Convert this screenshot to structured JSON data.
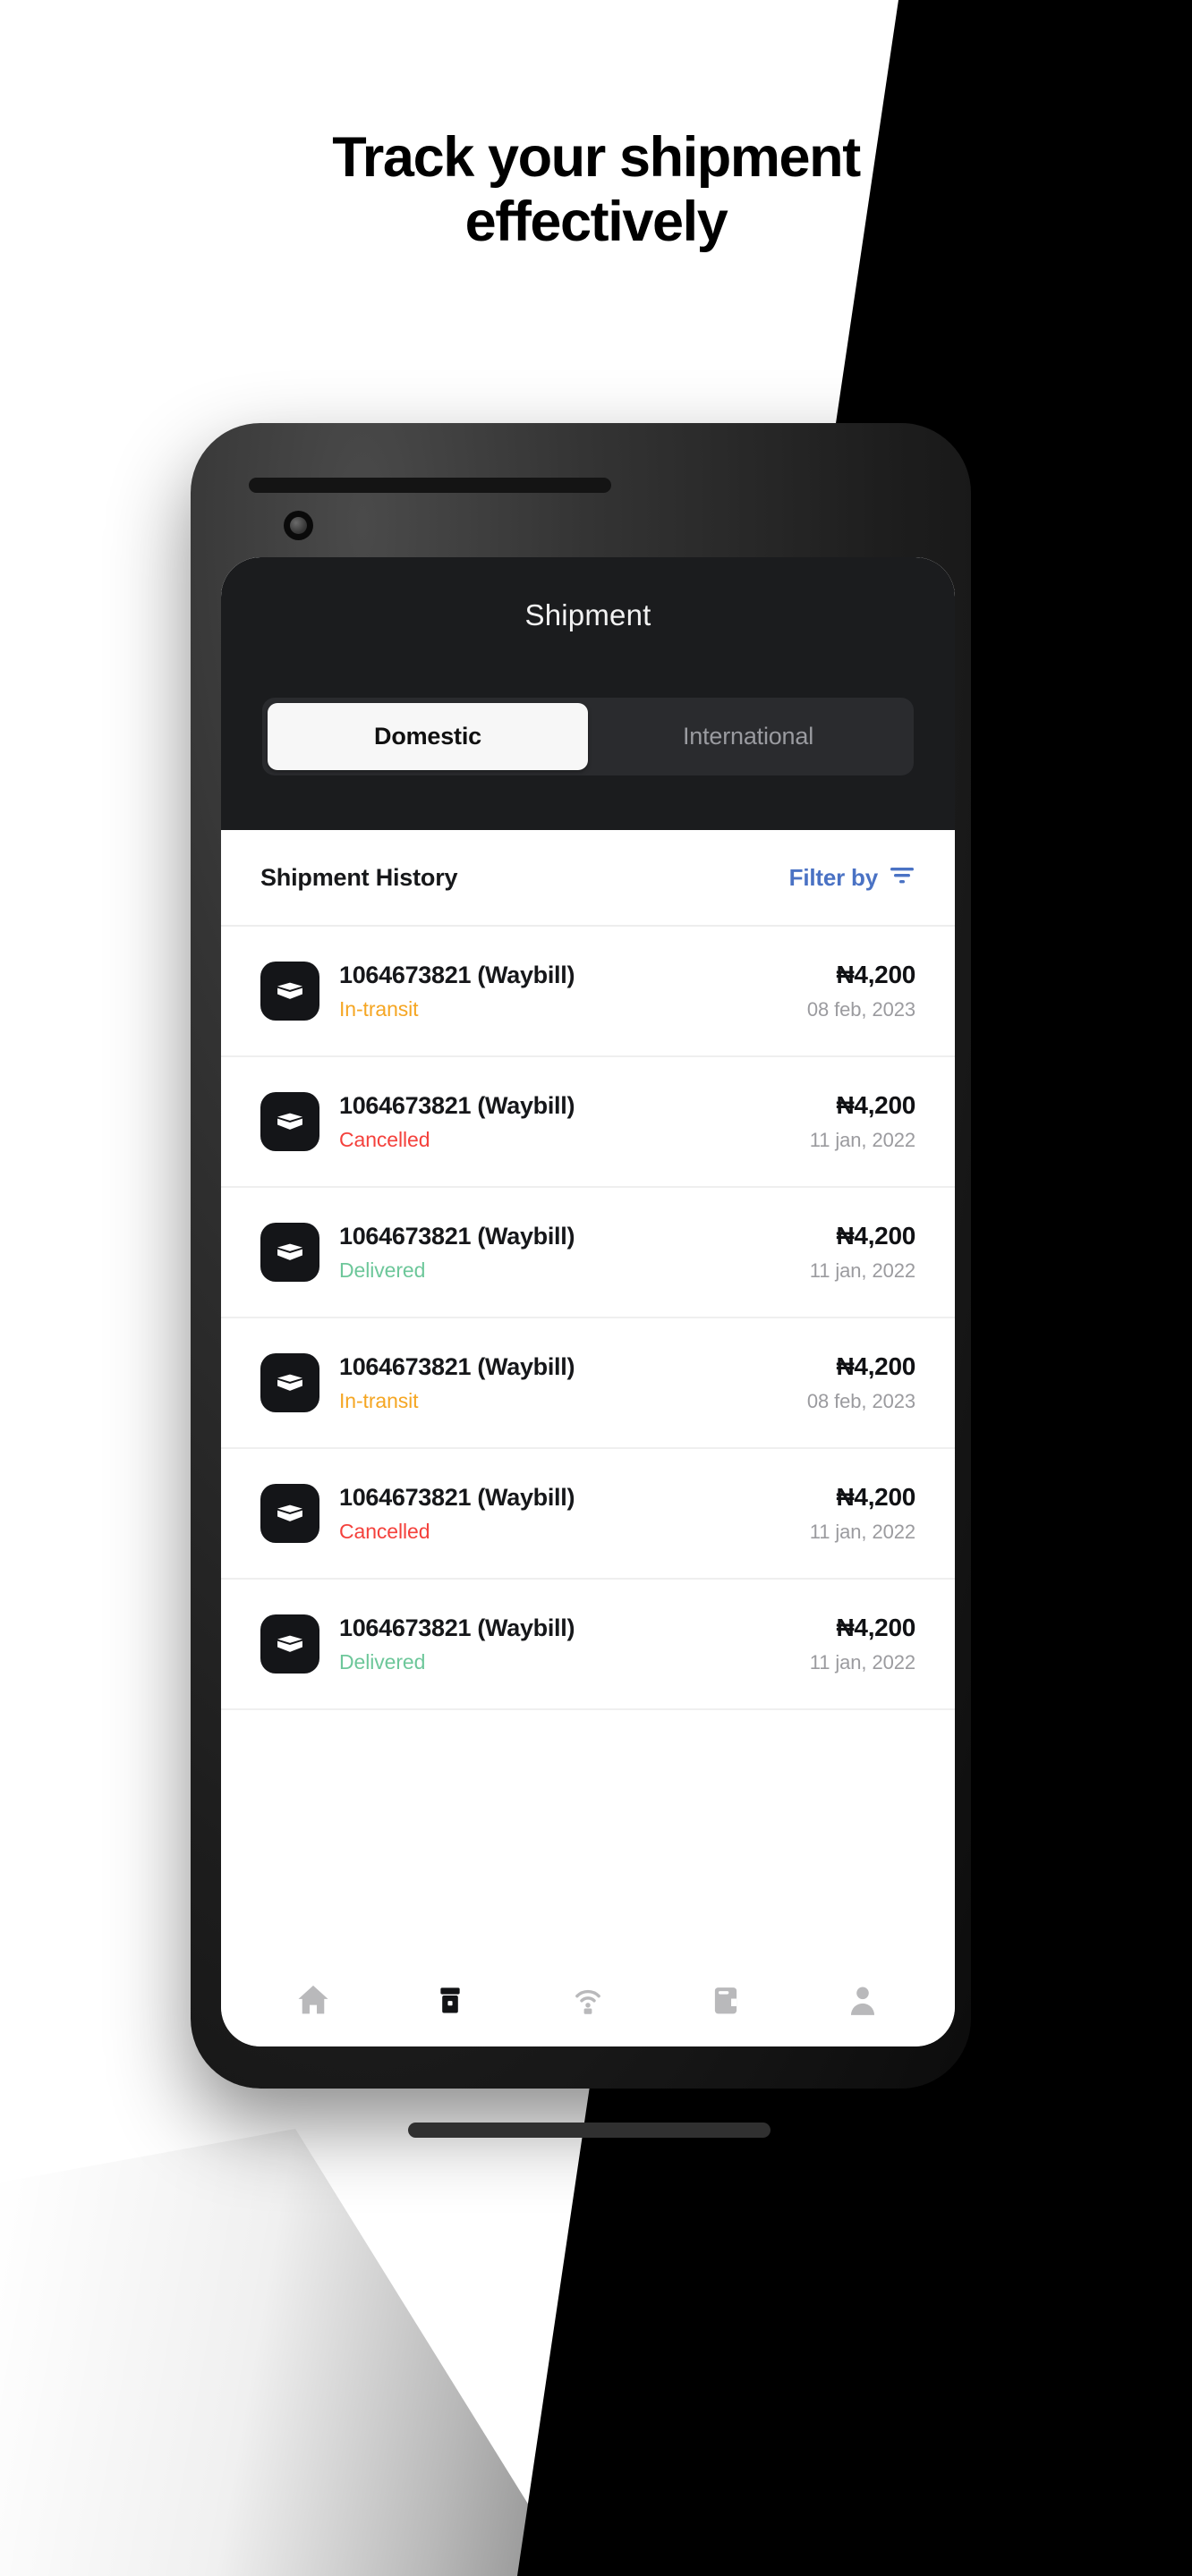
{
  "headline": {
    "line1": "Track your shipment",
    "line2": "effectively"
  },
  "colors": {
    "background": "#ffffff",
    "wedge": "#000000",
    "app_header_bg": "#1b1c1e",
    "accent_blue": "#4a72c4",
    "status_in_transit": "#f5a623",
    "status_cancelled": "#f4413c",
    "status_delivered": "#6dc79a",
    "active_tab_bg": "#f7f7f7",
    "icon_tile_bg": "#141518"
  },
  "app": {
    "title": "Shipment",
    "tabs": [
      {
        "label": "Domestic",
        "active": true
      },
      {
        "label": "International",
        "active": false
      }
    ],
    "list": {
      "title": "Shipment History",
      "filter_label": "Filter by",
      "filter_icon": "filter-icon",
      "rows": [
        {
          "icon": "package-box-icon",
          "id": "1064673821 (Waybill)",
          "status": "In-transit",
          "status_color": "#f5a623",
          "amount": "₦4,200",
          "date": "08 feb, 2023"
        },
        {
          "icon": "package-box-icon",
          "id": "1064673821 (Waybill)",
          "status": "Cancelled",
          "status_color": "#f4413c",
          "amount": "₦4,200",
          "date": "11 jan, 2022"
        },
        {
          "icon": "package-box-icon",
          "id": "1064673821 (Waybill)",
          "status": "Delivered",
          "status_color": "#6dc79a",
          "amount": "₦4,200",
          "date": "11 jan, 2022"
        },
        {
          "icon": "package-box-icon",
          "id": "1064673821 (Waybill)",
          "status": "In-transit",
          "status_color": "#f5a623",
          "amount": "₦4,200",
          "date": "08 feb, 2023"
        },
        {
          "icon": "package-box-icon",
          "id": "1064673821 (Waybill)",
          "status": "Cancelled",
          "status_color": "#f4413c",
          "amount": "₦4,200",
          "date": "11 jan, 2022"
        },
        {
          "icon": "package-box-icon",
          "id": "1064673821 (Waybill)",
          "status": "Delivered",
          "status_color": "#6dc79a",
          "amount": "₦4,200",
          "date": "11 jan, 2022"
        }
      ]
    },
    "bottom_nav": [
      {
        "icon": "home-icon",
        "active": false
      },
      {
        "icon": "shipment-box-icon",
        "active": true
      },
      {
        "icon": "tracking-signal-icon",
        "active": false
      },
      {
        "icon": "wallet-icon",
        "active": false
      },
      {
        "icon": "profile-person-icon",
        "active": false
      }
    ]
  }
}
